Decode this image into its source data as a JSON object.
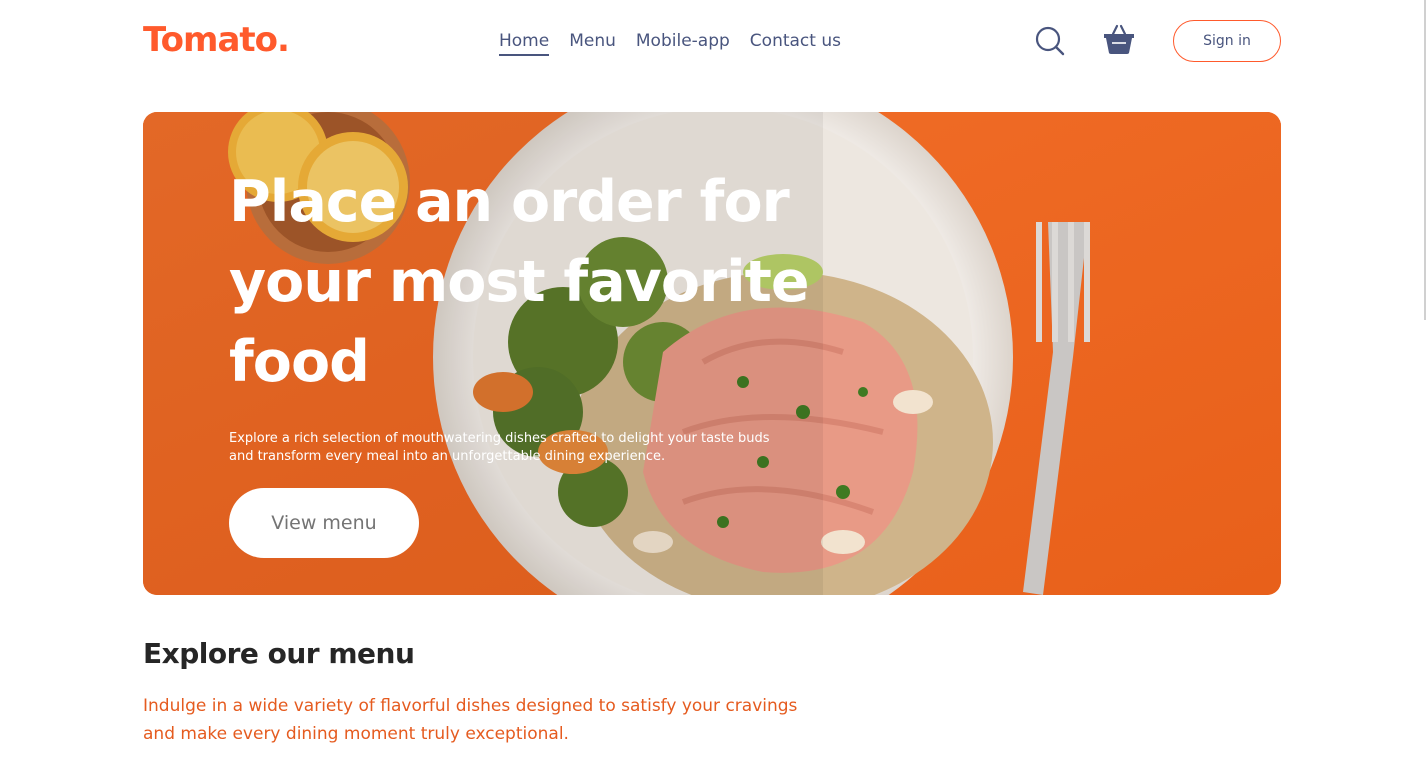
{
  "brand": {
    "logo": "Tomato.",
    "accent_color": "#ff5a2c",
    "nav_color": "#49557e"
  },
  "nav": {
    "links": [
      {
        "label": "Home",
        "active": true
      },
      {
        "label": "Menu",
        "active": false
      },
      {
        "label": "Mobile-app",
        "active": false
      },
      {
        "label": "Contact us",
        "active": false
      }
    ],
    "search_icon": "search-icon",
    "basket_icon": "basket-icon",
    "signin_label": "Sign in"
  },
  "hero": {
    "title": "Place an order for your most favorite food",
    "description": "Explore a rich selection of mouthwatering dishes crafted to delight your taste buds and transform every meal into an unforgettable dining experience.",
    "button_label": "View menu",
    "background_color": "#ee6a22",
    "image": "food-plate-image"
  },
  "explore": {
    "title": "Explore our menu",
    "text": "Indulge in a wide variety of flavorful dishes designed to satisfy your cravings and make every dining moment truly exceptional.",
    "text_color": "#e55b1f"
  }
}
